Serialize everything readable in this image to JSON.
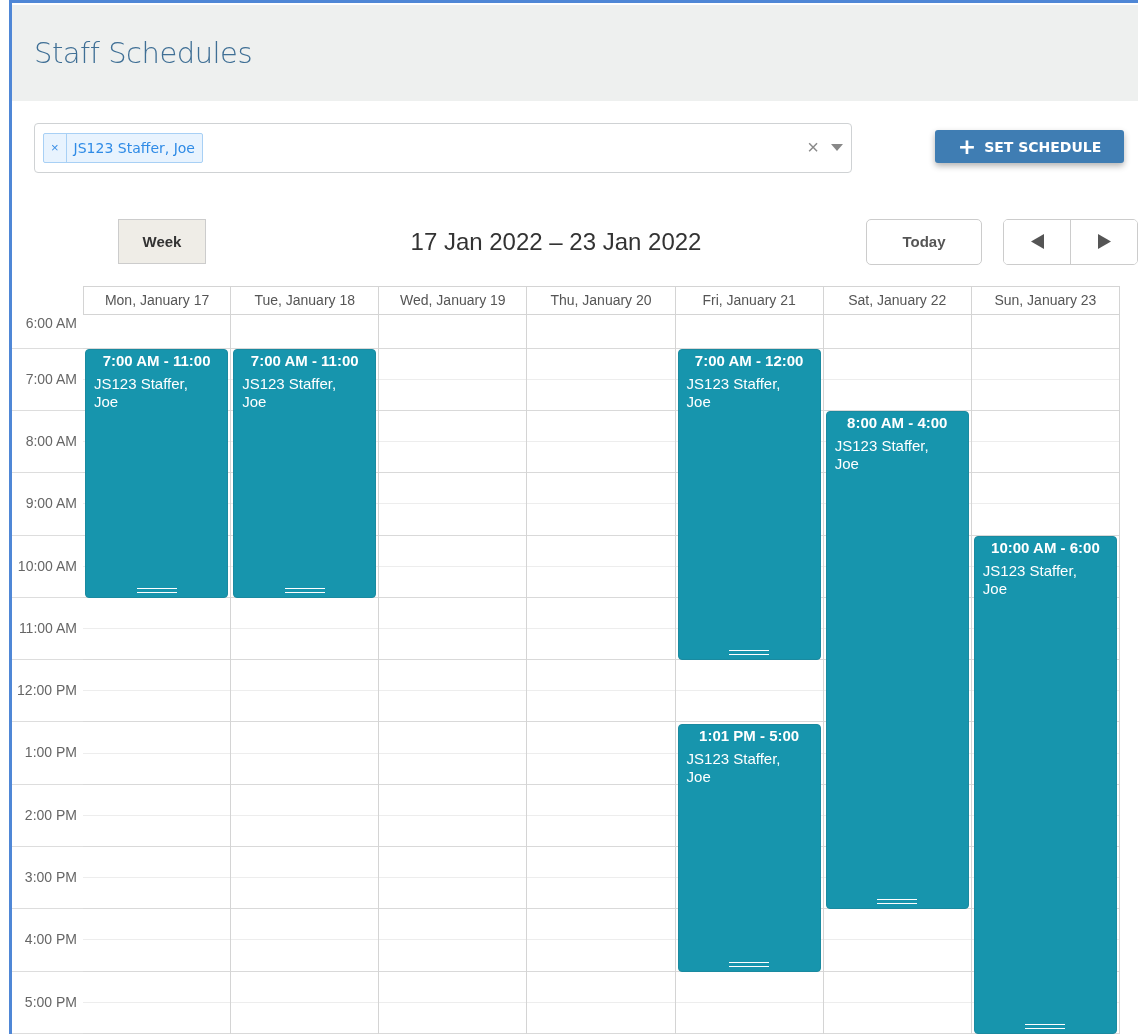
{
  "page": {
    "title": "Staff Schedules"
  },
  "staff_select": {
    "tags": [
      {
        "remove": "×",
        "label": "JS123 Staffer, Joe"
      }
    ],
    "clear": "×"
  },
  "set_schedule_button": {
    "icon": "+",
    "label": "SET SCHEDULE"
  },
  "toolbar": {
    "views": [
      {
        "label": "Week",
        "selected": true
      }
    ],
    "range": "17 Jan 2022 – 23 Jan 2022",
    "today": "Today"
  },
  "time_labels": [
    "6:00 AM",
    "7:00 AM",
    "8:00 AM",
    "9:00 AM",
    "10:00 AM",
    "11:00 AM",
    "12:00 PM",
    "1:00 PM",
    "2:00 PM",
    "3:00 PM",
    "4:00 PM",
    "5:00 PM"
  ],
  "days": [
    {
      "header": "Mon, January 17",
      "events": [
        {
          "time": "7:00 AM - 11:00",
          "name": "JS123 Staffer, Joe"
        }
      ]
    },
    {
      "header": "Tue, January 18",
      "events": [
        {
          "time": "7:00 AM - 11:00",
          "name": "JS123 Staffer, Joe"
        }
      ]
    },
    {
      "header": "Wed, January 19"
    },
    {
      "header": "Thu, January 20"
    },
    {
      "header": "Fri, January 21",
      "events": [
        {
          "time": "7:00 AM - 12:00",
          "name": "JS123 Staffer, Joe"
        },
        {
          "time": "1:01 PM - 5:00",
          "name": "JS123 Staffer, Joe"
        }
      ]
    },
    {
      "header": "Sat, January 22",
      "events": [
        {
          "time": "8:00 AM - 4:00",
          "name": "JS123 Staffer, Joe"
        }
      ]
    },
    {
      "header": "Sun, January 23",
      "events": [
        {
          "time": "10:00 AM - 6:00",
          "name": "JS123 Staffer, Joe"
        }
      ]
    }
  ]
}
